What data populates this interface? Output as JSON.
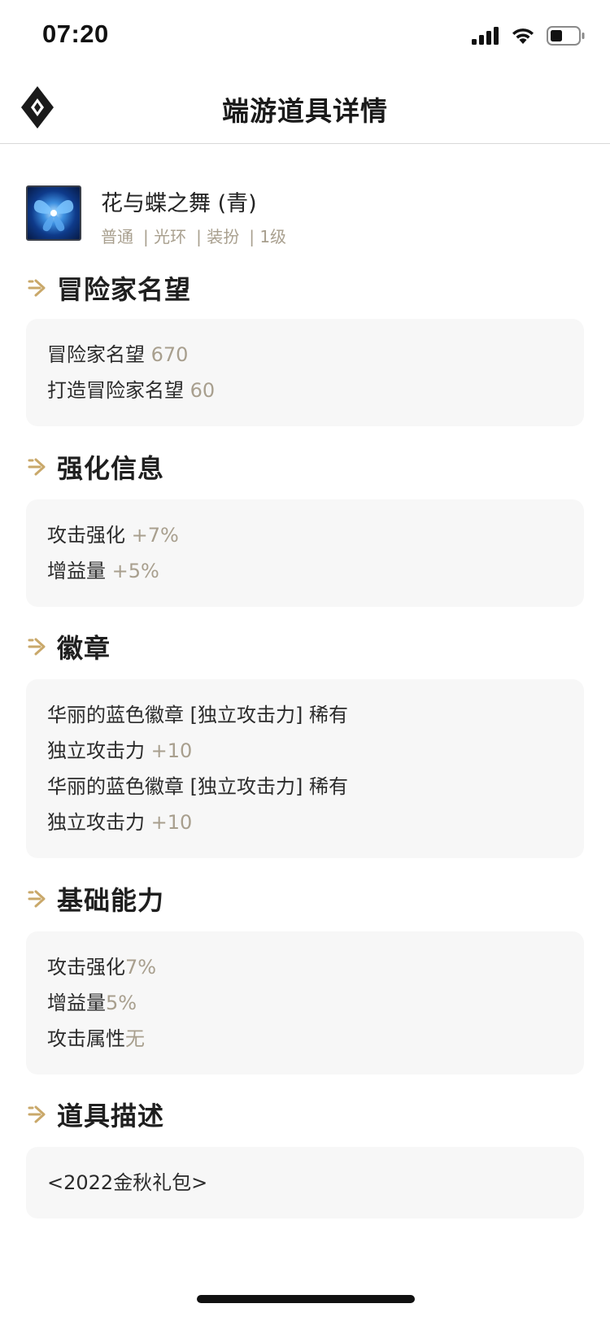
{
  "status_bar": {
    "time": "07:20"
  },
  "nav": {
    "title": "端游道具详情"
  },
  "item": {
    "name": "花与蝶之舞 (青)",
    "tags": [
      "普通",
      "| 光环",
      "| 装扮",
      "| 1级"
    ]
  },
  "sections": {
    "reputation": {
      "title": "冒险家名望",
      "lines": [
        {
          "label": "冒险家名望 ",
          "value": "670"
        },
        {
          "label": "打造冒险家名望 ",
          "value": "60"
        }
      ]
    },
    "enhance": {
      "title": "强化信息",
      "lines": [
        {
          "label": "攻击强化 ",
          "value": "+7%"
        },
        {
          "label": "增益量 ",
          "value": "+5%"
        }
      ]
    },
    "emblem": {
      "title": "徽章",
      "lines": [
        {
          "label": "华丽的蓝色徽章 [独立攻击力] 稀有",
          "value": ""
        },
        {
          "label": "独立攻击力 ",
          "value": "+10"
        },
        {
          "label": "华丽的蓝色徽章 [独立攻击力] 稀有",
          "value": ""
        },
        {
          "label": "独立攻击力 ",
          "value": "+10"
        }
      ]
    },
    "base": {
      "title": "基础能力",
      "lines": [
        {
          "label": "攻击强化",
          "value": "7%"
        },
        {
          "label": "增益量",
          "value": "5%"
        },
        {
          "label": "攻击属性",
          "value": "无"
        }
      ]
    },
    "desc": {
      "title": "道具描述",
      "lines": [
        {
          "label": "<2022金秋礼包>",
          "value": ""
        }
      ]
    }
  },
  "colors": {
    "accent": "#c9a86a",
    "muted": "#a89f8e",
    "card_bg": "#f7f7f7"
  },
  "icons": [
    "signal-icon",
    "wifi-icon",
    "battery-icon",
    "app-logo-icon",
    "section-arrow-icon",
    "butterfly-item-icon"
  ]
}
